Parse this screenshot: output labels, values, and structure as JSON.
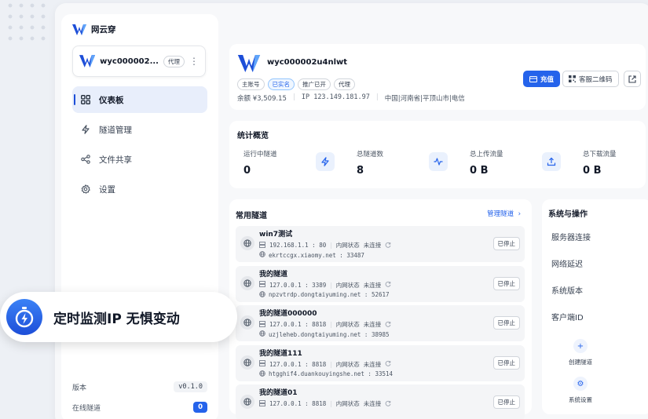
{
  "brand": {
    "name": "网云穿",
    "accent": "#2563eb"
  },
  "account": {
    "short_name": "wyc000002...",
    "role_tag": "代理"
  },
  "nav": [
    {
      "label": "仪表板",
      "icon": "grid-icon",
      "active": true
    },
    {
      "label": "隧道管理",
      "icon": "bolt-icon",
      "active": false
    },
    {
      "label": "文件共享",
      "icon": "share-icon",
      "active": false
    },
    {
      "label": "设置",
      "icon": "gear-icon",
      "active": false
    }
  ],
  "footer": {
    "version_label": "版本",
    "version": "v0.1.0",
    "online_label": "在线隧道",
    "online_count": "0"
  },
  "profile": {
    "name": "wyc000002u4nlwt",
    "tags": [
      "主账号",
      "已实名",
      "推广已开",
      "代理"
    ],
    "balance": "余额 ¥3,509.15",
    "ip": "IP 123.149.181.97",
    "location": "中国|河南省|平顶山市|电信",
    "recharge_label": "充值",
    "qr_label": "客服二维码"
  },
  "stats": {
    "title": "统计概览",
    "items": [
      {
        "label": "运行中隧道",
        "value": "0",
        "icon": "bolt-icon"
      },
      {
        "label": "总隧道数",
        "value": "8",
        "icon": "pulse-icon"
      },
      {
        "label": "总上传流量",
        "value": "0 B",
        "icon": "upload-icon"
      },
      {
        "label": "总下载流量",
        "value": "0 B",
        "icon": "download-icon"
      }
    ]
  },
  "tunnels": {
    "title": "常用隧道",
    "manage_label": "管理隧道",
    "status_label": "内网状态",
    "status_value": "未连接",
    "stopped_label": "已停止",
    "items": [
      {
        "name": "win7测试",
        "local": "192.168.1.1 : 80",
        "remote": "ekrtccgx.xiaomy.net : 33487"
      },
      {
        "name": "我的隧道",
        "local": "127.0.0.1 : 3389",
        "remote": "npzvtrdp.dongtaiyuming.net : 52617"
      },
      {
        "name": "我的隧道000000",
        "local": "127.0.0.1 : 8818",
        "remote": "uzjleheb.dongtaiyuming.net : 38985"
      },
      {
        "name": "我的隧道111",
        "local": "127.0.0.1 : 8818",
        "remote": "htgghif4.duankouyingshe.net : 33514"
      },
      {
        "name": "我的隧道01",
        "local": "127.0.0.1 : 8818",
        "remote": ""
      }
    ]
  },
  "system": {
    "title": "系统与操作",
    "items": [
      "服务器连接",
      "网络延迟",
      "系统版本",
      "客户端ID"
    ],
    "quick": [
      {
        "label": "创建隧道",
        "glyph": "+"
      },
      {
        "label": "系统设置",
        "glyph": "⚙"
      }
    ]
  },
  "promo": {
    "text": "定时监测IP 无惧变动"
  }
}
